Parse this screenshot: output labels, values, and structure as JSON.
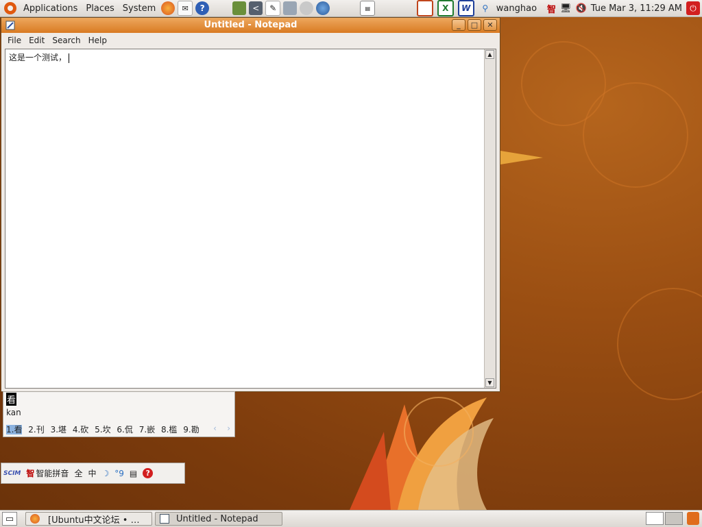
{
  "top_panel": {
    "menus": [
      "Applications",
      "Places",
      "System"
    ],
    "launchers": [
      "firefox-icon",
      "mail-icon",
      "help-icon",
      "book-icon",
      "terminal-icon",
      "notes-icon",
      "settings-icon",
      "disk-icon",
      "thunderbird-icon",
      "screenshot-icon"
    ],
    "tray_icons": [
      "presentation-icon",
      "spreadsheet-icon",
      "word-icon",
      "network-icon"
    ],
    "user": "wanghao",
    "ime_indicator": "智",
    "clock": "Tue Mar  3, 11:29 AM"
  },
  "window": {
    "title": "Untitled - Notepad",
    "menu": [
      "File",
      "Edit",
      "Search",
      "Help"
    ],
    "content": "这是一个测试，"
  },
  "ime": {
    "preedit": "看",
    "pinyin": "kan",
    "candidates": [
      "1.看",
      "2.刊",
      "3.堪",
      "4.砍",
      "5.坎",
      "6.侃",
      "7.嵌",
      "8.槛",
      "9.勘"
    ],
    "toolbar": {
      "logo": "SCIM",
      "mode_icon": "智",
      "method": "智能拼音",
      "full_width": "全",
      "lang": "中",
      "moon": "☽",
      "punct": "°9"
    }
  },
  "bottom_panel": {
    "tasks": [
      "[Ubuntu中文论坛  • …",
      "Untitled - Notepad"
    ]
  }
}
